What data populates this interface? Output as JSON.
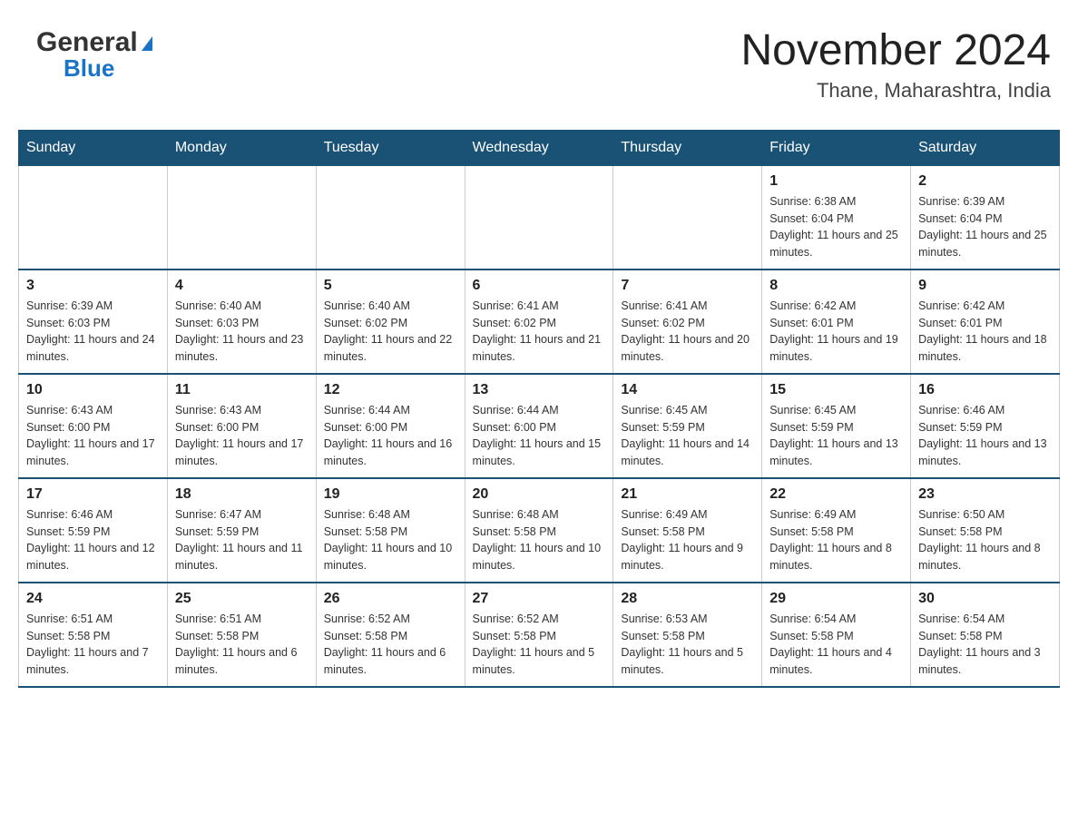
{
  "header": {
    "logo_general": "General",
    "logo_blue": "Blue",
    "month_title": "November 2024",
    "location": "Thane, Maharashtra, India"
  },
  "weekdays": [
    "Sunday",
    "Monday",
    "Tuesday",
    "Wednesday",
    "Thursday",
    "Friday",
    "Saturday"
  ],
  "rows": [
    {
      "cells": [
        {
          "day": "",
          "info": ""
        },
        {
          "day": "",
          "info": ""
        },
        {
          "day": "",
          "info": ""
        },
        {
          "day": "",
          "info": ""
        },
        {
          "day": "",
          "info": ""
        },
        {
          "day": "1",
          "info": "Sunrise: 6:38 AM\nSunset: 6:04 PM\nDaylight: 11 hours and 25 minutes."
        },
        {
          "day": "2",
          "info": "Sunrise: 6:39 AM\nSunset: 6:04 PM\nDaylight: 11 hours and 25 minutes."
        }
      ]
    },
    {
      "cells": [
        {
          "day": "3",
          "info": "Sunrise: 6:39 AM\nSunset: 6:03 PM\nDaylight: 11 hours and 24 minutes."
        },
        {
          "day": "4",
          "info": "Sunrise: 6:40 AM\nSunset: 6:03 PM\nDaylight: 11 hours and 23 minutes."
        },
        {
          "day": "5",
          "info": "Sunrise: 6:40 AM\nSunset: 6:02 PM\nDaylight: 11 hours and 22 minutes."
        },
        {
          "day": "6",
          "info": "Sunrise: 6:41 AM\nSunset: 6:02 PM\nDaylight: 11 hours and 21 minutes."
        },
        {
          "day": "7",
          "info": "Sunrise: 6:41 AM\nSunset: 6:02 PM\nDaylight: 11 hours and 20 minutes."
        },
        {
          "day": "8",
          "info": "Sunrise: 6:42 AM\nSunset: 6:01 PM\nDaylight: 11 hours and 19 minutes."
        },
        {
          "day": "9",
          "info": "Sunrise: 6:42 AM\nSunset: 6:01 PM\nDaylight: 11 hours and 18 minutes."
        }
      ]
    },
    {
      "cells": [
        {
          "day": "10",
          "info": "Sunrise: 6:43 AM\nSunset: 6:00 PM\nDaylight: 11 hours and 17 minutes."
        },
        {
          "day": "11",
          "info": "Sunrise: 6:43 AM\nSunset: 6:00 PM\nDaylight: 11 hours and 17 minutes."
        },
        {
          "day": "12",
          "info": "Sunrise: 6:44 AM\nSunset: 6:00 PM\nDaylight: 11 hours and 16 minutes."
        },
        {
          "day": "13",
          "info": "Sunrise: 6:44 AM\nSunset: 6:00 PM\nDaylight: 11 hours and 15 minutes."
        },
        {
          "day": "14",
          "info": "Sunrise: 6:45 AM\nSunset: 5:59 PM\nDaylight: 11 hours and 14 minutes."
        },
        {
          "day": "15",
          "info": "Sunrise: 6:45 AM\nSunset: 5:59 PM\nDaylight: 11 hours and 13 minutes."
        },
        {
          "day": "16",
          "info": "Sunrise: 6:46 AM\nSunset: 5:59 PM\nDaylight: 11 hours and 13 minutes."
        }
      ]
    },
    {
      "cells": [
        {
          "day": "17",
          "info": "Sunrise: 6:46 AM\nSunset: 5:59 PM\nDaylight: 11 hours and 12 minutes."
        },
        {
          "day": "18",
          "info": "Sunrise: 6:47 AM\nSunset: 5:59 PM\nDaylight: 11 hours and 11 minutes."
        },
        {
          "day": "19",
          "info": "Sunrise: 6:48 AM\nSunset: 5:58 PM\nDaylight: 11 hours and 10 minutes."
        },
        {
          "day": "20",
          "info": "Sunrise: 6:48 AM\nSunset: 5:58 PM\nDaylight: 11 hours and 10 minutes."
        },
        {
          "day": "21",
          "info": "Sunrise: 6:49 AM\nSunset: 5:58 PM\nDaylight: 11 hours and 9 minutes."
        },
        {
          "day": "22",
          "info": "Sunrise: 6:49 AM\nSunset: 5:58 PM\nDaylight: 11 hours and 8 minutes."
        },
        {
          "day": "23",
          "info": "Sunrise: 6:50 AM\nSunset: 5:58 PM\nDaylight: 11 hours and 8 minutes."
        }
      ]
    },
    {
      "cells": [
        {
          "day": "24",
          "info": "Sunrise: 6:51 AM\nSunset: 5:58 PM\nDaylight: 11 hours and 7 minutes."
        },
        {
          "day": "25",
          "info": "Sunrise: 6:51 AM\nSunset: 5:58 PM\nDaylight: 11 hours and 6 minutes."
        },
        {
          "day": "26",
          "info": "Sunrise: 6:52 AM\nSunset: 5:58 PM\nDaylight: 11 hours and 6 minutes."
        },
        {
          "day": "27",
          "info": "Sunrise: 6:52 AM\nSunset: 5:58 PM\nDaylight: 11 hours and 5 minutes."
        },
        {
          "day": "28",
          "info": "Sunrise: 6:53 AM\nSunset: 5:58 PM\nDaylight: 11 hours and 5 minutes."
        },
        {
          "day": "29",
          "info": "Sunrise: 6:54 AM\nSunset: 5:58 PM\nDaylight: 11 hours and 4 minutes."
        },
        {
          "day": "30",
          "info": "Sunrise: 6:54 AM\nSunset: 5:58 PM\nDaylight: 11 hours and 3 minutes."
        }
      ]
    }
  ]
}
